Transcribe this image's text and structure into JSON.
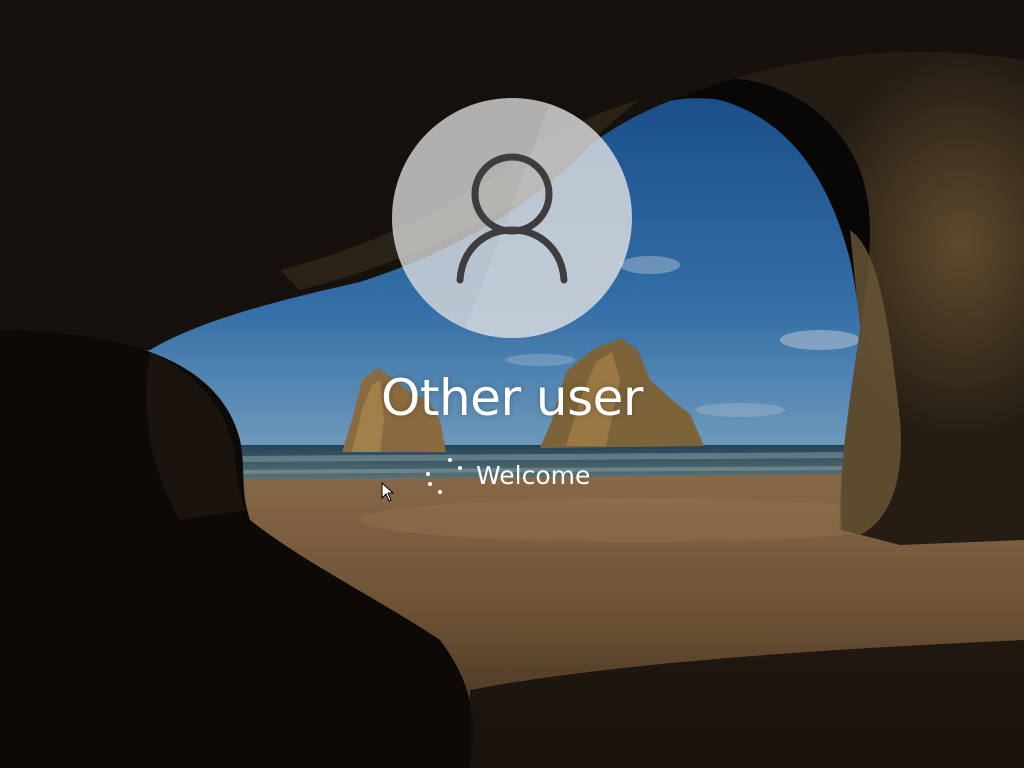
{
  "login": {
    "user_name": "Other user",
    "status_text": "Welcome"
  },
  "icons": {
    "avatar": "person-icon",
    "spinner": "loading-spinner-icon",
    "cursor": "mouse-pointer-icon"
  },
  "colors": {
    "text": "#ffffff",
    "avatar_fill": "#dedede",
    "sky": "#2f6fb0",
    "sand": "#8a6a44"
  }
}
